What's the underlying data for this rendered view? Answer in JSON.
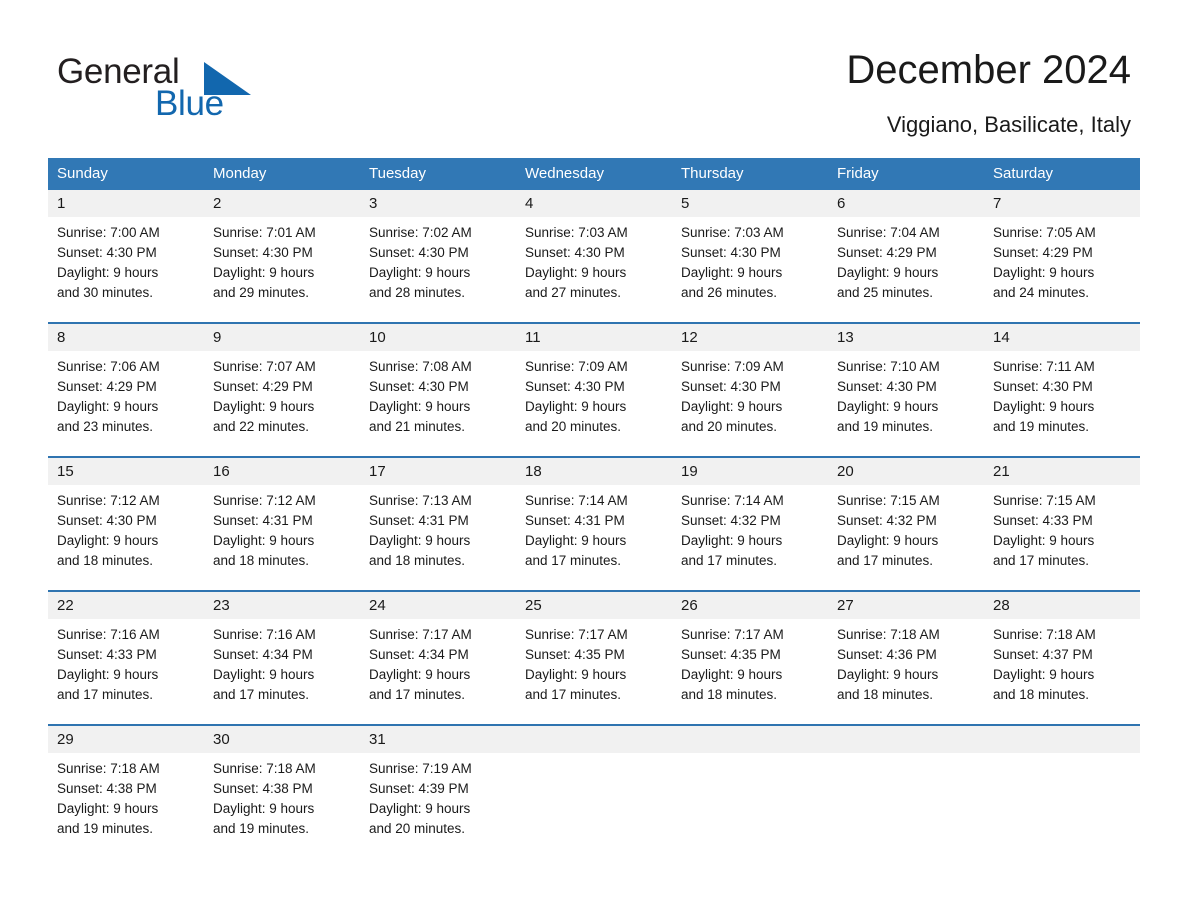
{
  "brand": {
    "name_part1": "General",
    "name_part2": "Blue",
    "triangle_color": "#1267ae",
    "text_color": "#231f20"
  },
  "header": {
    "title": "December 2024",
    "subtitle": "Viggiano, Basilicate, Italy"
  },
  "theme": {
    "header_bg": "#3178b5",
    "header_text": "#ffffff",
    "daynum_bg": "#f1f1f1",
    "cell_bg": "#ffffff",
    "week_rule": "#2f74b0",
    "body_text": "#1a1a1a"
  },
  "calendar": {
    "weekday_headers": [
      "Sunday",
      "Monday",
      "Tuesday",
      "Wednesday",
      "Thursday",
      "Friday",
      "Saturday"
    ],
    "labels": {
      "sunrise": "Sunrise:",
      "sunset": "Sunset:",
      "daylight": "Daylight:"
    },
    "weeks": [
      [
        {
          "day": "1",
          "sunrise": "Sunrise: 7:00 AM",
          "sunset": "Sunset: 4:30 PM",
          "daylight_line1": "Daylight: 9 hours",
          "daylight_line2": "and 30 minutes."
        },
        {
          "day": "2",
          "sunrise": "Sunrise: 7:01 AM",
          "sunset": "Sunset: 4:30 PM",
          "daylight_line1": "Daylight: 9 hours",
          "daylight_line2": "and 29 minutes."
        },
        {
          "day": "3",
          "sunrise": "Sunrise: 7:02 AM",
          "sunset": "Sunset: 4:30 PM",
          "daylight_line1": "Daylight: 9 hours",
          "daylight_line2": "and 28 minutes."
        },
        {
          "day": "4",
          "sunrise": "Sunrise: 7:03 AM",
          "sunset": "Sunset: 4:30 PM",
          "daylight_line1": "Daylight: 9 hours",
          "daylight_line2": "and 27 minutes."
        },
        {
          "day": "5",
          "sunrise": "Sunrise: 7:03 AM",
          "sunset": "Sunset: 4:30 PM",
          "daylight_line1": "Daylight: 9 hours",
          "daylight_line2": "and 26 minutes."
        },
        {
          "day": "6",
          "sunrise": "Sunrise: 7:04 AM",
          "sunset": "Sunset: 4:29 PM",
          "daylight_line1": "Daylight: 9 hours",
          "daylight_line2": "and 25 minutes."
        },
        {
          "day": "7",
          "sunrise": "Sunrise: 7:05 AM",
          "sunset": "Sunset: 4:29 PM",
          "daylight_line1": "Daylight: 9 hours",
          "daylight_line2": "and 24 minutes."
        }
      ],
      [
        {
          "day": "8",
          "sunrise": "Sunrise: 7:06 AM",
          "sunset": "Sunset: 4:29 PM",
          "daylight_line1": "Daylight: 9 hours",
          "daylight_line2": "and 23 minutes."
        },
        {
          "day": "9",
          "sunrise": "Sunrise: 7:07 AM",
          "sunset": "Sunset: 4:29 PM",
          "daylight_line1": "Daylight: 9 hours",
          "daylight_line2": "and 22 minutes."
        },
        {
          "day": "10",
          "sunrise": "Sunrise: 7:08 AM",
          "sunset": "Sunset: 4:30 PM",
          "daylight_line1": "Daylight: 9 hours",
          "daylight_line2": "and 21 minutes."
        },
        {
          "day": "11",
          "sunrise": "Sunrise: 7:09 AM",
          "sunset": "Sunset: 4:30 PM",
          "daylight_line1": "Daylight: 9 hours",
          "daylight_line2": "and 20 minutes."
        },
        {
          "day": "12",
          "sunrise": "Sunrise: 7:09 AM",
          "sunset": "Sunset: 4:30 PM",
          "daylight_line1": "Daylight: 9 hours",
          "daylight_line2": "and 20 minutes."
        },
        {
          "day": "13",
          "sunrise": "Sunrise: 7:10 AM",
          "sunset": "Sunset: 4:30 PM",
          "daylight_line1": "Daylight: 9 hours",
          "daylight_line2": "and 19 minutes."
        },
        {
          "day": "14",
          "sunrise": "Sunrise: 7:11 AM",
          "sunset": "Sunset: 4:30 PM",
          "daylight_line1": "Daylight: 9 hours",
          "daylight_line2": "and 19 minutes."
        }
      ],
      [
        {
          "day": "15",
          "sunrise": "Sunrise: 7:12 AM",
          "sunset": "Sunset: 4:30 PM",
          "daylight_line1": "Daylight: 9 hours",
          "daylight_line2": "and 18 minutes."
        },
        {
          "day": "16",
          "sunrise": "Sunrise: 7:12 AM",
          "sunset": "Sunset: 4:31 PM",
          "daylight_line1": "Daylight: 9 hours",
          "daylight_line2": "and 18 minutes."
        },
        {
          "day": "17",
          "sunrise": "Sunrise: 7:13 AM",
          "sunset": "Sunset: 4:31 PM",
          "daylight_line1": "Daylight: 9 hours",
          "daylight_line2": "and 18 minutes."
        },
        {
          "day": "18",
          "sunrise": "Sunrise: 7:14 AM",
          "sunset": "Sunset: 4:31 PM",
          "daylight_line1": "Daylight: 9 hours",
          "daylight_line2": "and 17 minutes."
        },
        {
          "day": "19",
          "sunrise": "Sunrise: 7:14 AM",
          "sunset": "Sunset: 4:32 PM",
          "daylight_line1": "Daylight: 9 hours",
          "daylight_line2": "and 17 minutes."
        },
        {
          "day": "20",
          "sunrise": "Sunrise: 7:15 AM",
          "sunset": "Sunset: 4:32 PM",
          "daylight_line1": "Daylight: 9 hours",
          "daylight_line2": "and 17 minutes."
        },
        {
          "day": "21",
          "sunrise": "Sunrise: 7:15 AM",
          "sunset": "Sunset: 4:33 PM",
          "daylight_line1": "Daylight: 9 hours",
          "daylight_line2": "and 17 minutes."
        }
      ],
      [
        {
          "day": "22",
          "sunrise": "Sunrise: 7:16 AM",
          "sunset": "Sunset: 4:33 PM",
          "daylight_line1": "Daylight: 9 hours",
          "daylight_line2": "and 17 minutes."
        },
        {
          "day": "23",
          "sunrise": "Sunrise: 7:16 AM",
          "sunset": "Sunset: 4:34 PM",
          "daylight_line1": "Daylight: 9 hours",
          "daylight_line2": "and 17 minutes."
        },
        {
          "day": "24",
          "sunrise": "Sunrise: 7:17 AM",
          "sunset": "Sunset: 4:34 PM",
          "daylight_line1": "Daylight: 9 hours",
          "daylight_line2": "and 17 minutes."
        },
        {
          "day": "25",
          "sunrise": "Sunrise: 7:17 AM",
          "sunset": "Sunset: 4:35 PM",
          "daylight_line1": "Daylight: 9 hours",
          "daylight_line2": "and 17 minutes."
        },
        {
          "day": "26",
          "sunrise": "Sunrise: 7:17 AM",
          "sunset": "Sunset: 4:35 PM",
          "daylight_line1": "Daylight: 9 hours",
          "daylight_line2": "and 18 minutes."
        },
        {
          "day": "27",
          "sunrise": "Sunrise: 7:18 AM",
          "sunset": "Sunset: 4:36 PM",
          "daylight_line1": "Daylight: 9 hours",
          "daylight_line2": "and 18 minutes."
        },
        {
          "day": "28",
          "sunrise": "Sunrise: 7:18 AM",
          "sunset": "Sunset: 4:37 PM",
          "daylight_line1": "Daylight: 9 hours",
          "daylight_line2": "and 18 minutes."
        }
      ],
      [
        {
          "day": "29",
          "sunrise": "Sunrise: 7:18 AM",
          "sunset": "Sunset: 4:38 PM",
          "daylight_line1": "Daylight: 9 hours",
          "daylight_line2": "and 19 minutes."
        },
        {
          "day": "30",
          "sunrise": "Sunrise: 7:18 AM",
          "sunset": "Sunset: 4:38 PM",
          "daylight_line1": "Daylight: 9 hours",
          "daylight_line2": "and 19 minutes."
        },
        {
          "day": "31",
          "sunrise": "Sunrise: 7:19 AM",
          "sunset": "Sunset: 4:39 PM",
          "daylight_line1": "Daylight: 9 hours",
          "daylight_line2": "and 20 minutes."
        },
        {
          "day": "",
          "sunrise": "",
          "sunset": "",
          "daylight_line1": "",
          "daylight_line2": "",
          "empty": true
        },
        {
          "day": "",
          "sunrise": "",
          "sunset": "",
          "daylight_line1": "",
          "daylight_line2": "",
          "empty": true
        },
        {
          "day": "",
          "sunrise": "",
          "sunset": "",
          "daylight_line1": "",
          "daylight_line2": "",
          "empty": true
        },
        {
          "day": "",
          "sunrise": "",
          "sunset": "",
          "daylight_line1": "",
          "daylight_line2": "",
          "empty": true
        }
      ]
    ]
  }
}
